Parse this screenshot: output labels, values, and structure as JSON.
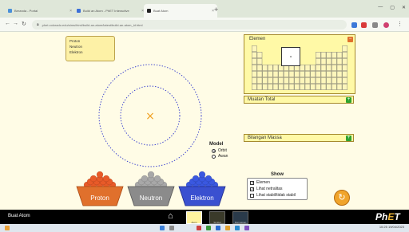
{
  "browser": {
    "tabs": [
      {
        "label": "Beranda - Portal",
        "active": false,
        "color": "#4a90d9"
      },
      {
        "label": "Build an Atom - PhET Interactive",
        "active": false,
        "color": "#3b6fd8"
      },
      {
        "label": "Buat Atom",
        "active": true,
        "color": "#222222"
      }
    ],
    "url": "phet.colorado.edu/sims/html/build-an-atom/latest/build-an-atom_id.html",
    "new_tab": "+"
  },
  "sim": {
    "legend": [
      "Proton",
      "Neutron",
      "Elektron"
    ],
    "nucleus_marker": "×",
    "element_panel": {
      "title": "Elemen",
      "minimize": "−",
      "selected_symbol": "-"
    },
    "net_charge": {
      "label": "Muatan Total",
      "expand": "+"
    },
    "mass_number": {
      "label": "Bilangan Massa",
      "expand": "+"
    },
    "model": {
      "title": "Model",
      "options": [
        {
          "label": "Orbit",
          "selected": true
        },
        {
          "label": "Awan",
          "selected": false
        }
      ]
    },
    "show": {
      "title": "Show",
      "items": [
        {
          "label": "Elemen",
          "checked": true
        },
        {
          "label": "Lihat netralitas",
          "checked": true
        },
        {
          "label": "Lihat stabil/tidak stabil",
          "checked": false
        }
      ]
    },
    "buckets": [
      {
        "label": "Proton",
        "bowl": "#e0702c",
        "ball": "#e85a28"
      },
      {
        "label": "Neutron",
        "bowl": "#8b8b8b",
        "ball": "#a8a8a8"
      },
      {
        "label": "Elektron",
        "bowl": "#3a50d0",
        "ball": "#3a58e0"
      }
    ],
    "reset_icon": "refresh-icon"
  },
  "navbar": {
    "title": "Buat Atom",
    "screens": [
      "Atom",
      "Simbol",
      "Permainan"
    ],
    "logo": "PhET"
  },
  "taskbar": {
    "time": "10:25",
    "date": "19/04/2023"
  }
}
